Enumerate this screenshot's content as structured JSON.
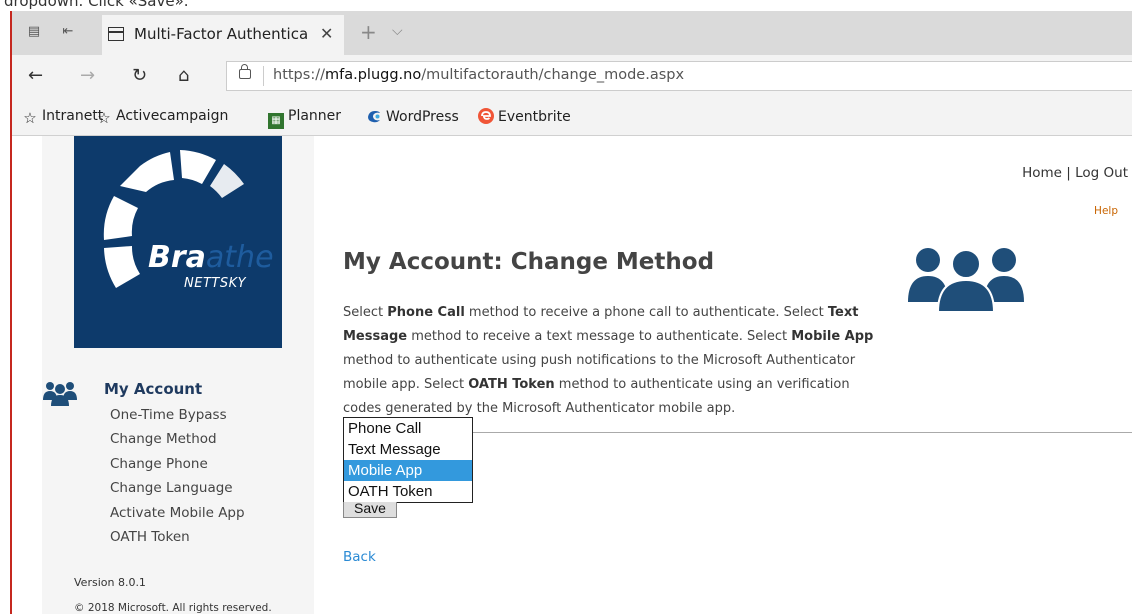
{
  "caption": "dropdown. Click «Save».",
  "browser": {
    "tab_title": "Multi-Factor Authentica",
    "url_prefix": "https://",
    "url_domain": "mfa.plugg.no",
    "url_path": "/multifactorauth/change_mode.aspx",
    "bookmarks": [
      {
        "label": "Intranett",
        "icon": "star-icon"
      },
      {
        "label": "Activecampaign",
        "icon": "star-icon"
      },
      {
        "label": "Planner",
        "icon": "planner-icon"
      },
      {
        "label": "WordPress",
        "icon": "wordpress-icon"
      },
      {
        "label": "Eventbrite",
        "icon": "eventbrite-icon"
      }
    ]
  },
  "header": {
    "home": "Home",
    "sep": " | ",
    "logout": "Log Out",
    "help": "Help"
  },
  "logo": {
    "bra": "Bra",
    "athe": "athe",
    "nettsky": "NETTSKY"
  },
  "sidebar": {
    "title": "My Account",
    "items": [
      "One-Time Bypass",
      "Change Method",
      "Change Phone",
      "Change Language",
      "Activate Mobile App",
      "OATH Token"
    ],
    "version": "Version 8.0.1",
    "copyright": "© 2018 Microsoft. All rights reserved."
  },
  "main": {
    "title": "My Account: Change Method",
    "desc": {
      "t1": "Select ",
      "b1": "Phone Call",
      "t2": " method to receive a phone call to authenticate. Select ",
      "b2": "Text Message",
      "t3": " method to receive a text message to authenticate. Select ",
      "b3": "Mobile App",
      "t4": " method to authenticate using push notifications to the Microsoft Authenticator mobile app. Select ",
      "b4": "OATH Token",
      "t5": " method to authenticate using an verification codes generated by the Microsoft Authenticator mobile app."
    },
    "options": [
      "Phone Call",
      "Text Message",
      "Mobile App",
      "OATH Token"
    ],
    "selected": "Mobile App",
    "save": "Save",
    "back": "Back"
  },
  "colors": {
    "logo_bg": "#0d3a6b",
    "accent": "#1f4e79",
    "selection": "#3399dd",
    "link": "#2a8ad4",
    "help": "#c86400"
  }
}
